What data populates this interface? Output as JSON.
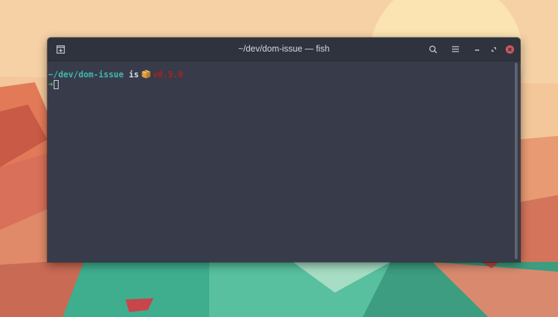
{
  "window": {
    "title": "~/dev/dom-issue — fish"
  },
  "titlebar": {
    "icons": [
      "new-tab-icon",
      "search-icon",
      "menu-icon",
      "minimize-icon",
      "restore-icon",
      "close-icon"
    ]
  },
  "terminal": {
    "prompt_cwd": "~/dev/dom-issue",
    "prompt_is": "is",
    "package_icon": "package-box-icon",
    "package_version": "v0.5.0",
    "prompt_symbol": "➜"
  },
  "colors": {
    "background": "#383c4a",
    "titlebar": "#2f333d",
    "cwd": "#3fb8b0",
    "version": "#b01e1e",
    "arrow": "#5fb63b",
    "close_button": "#cc575d"
  }
}
